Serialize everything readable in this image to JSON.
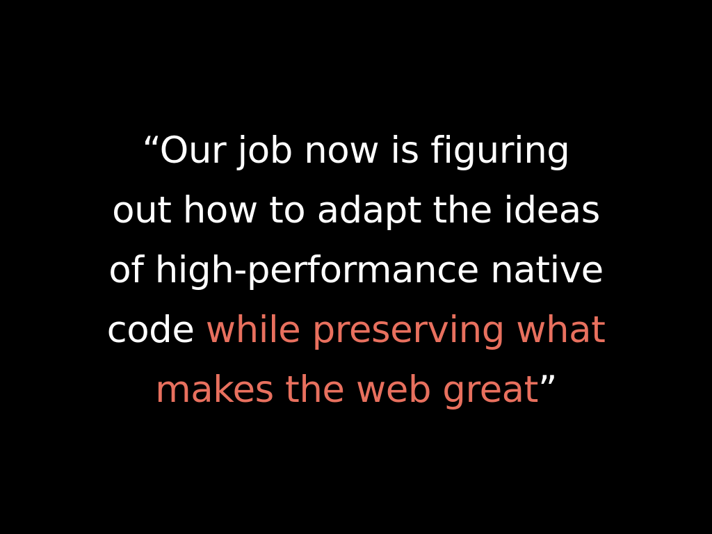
{
  "slide": {
    "colors": {
      "background": "#000000",
      "text": "#ffffff",
      "accent": "#e8705e"
    },
    "quote": {
      "line1": "“Our job now is figuring",
      "line2": "out how to adapt the ideas",
      "line3": "of high-performance native",
      "line4_plain": "code ",
      "line4_accent": "while preserving what",
      "line5_accent": "makes the web great",
      "close_mark": "”"
    }
  }
}
